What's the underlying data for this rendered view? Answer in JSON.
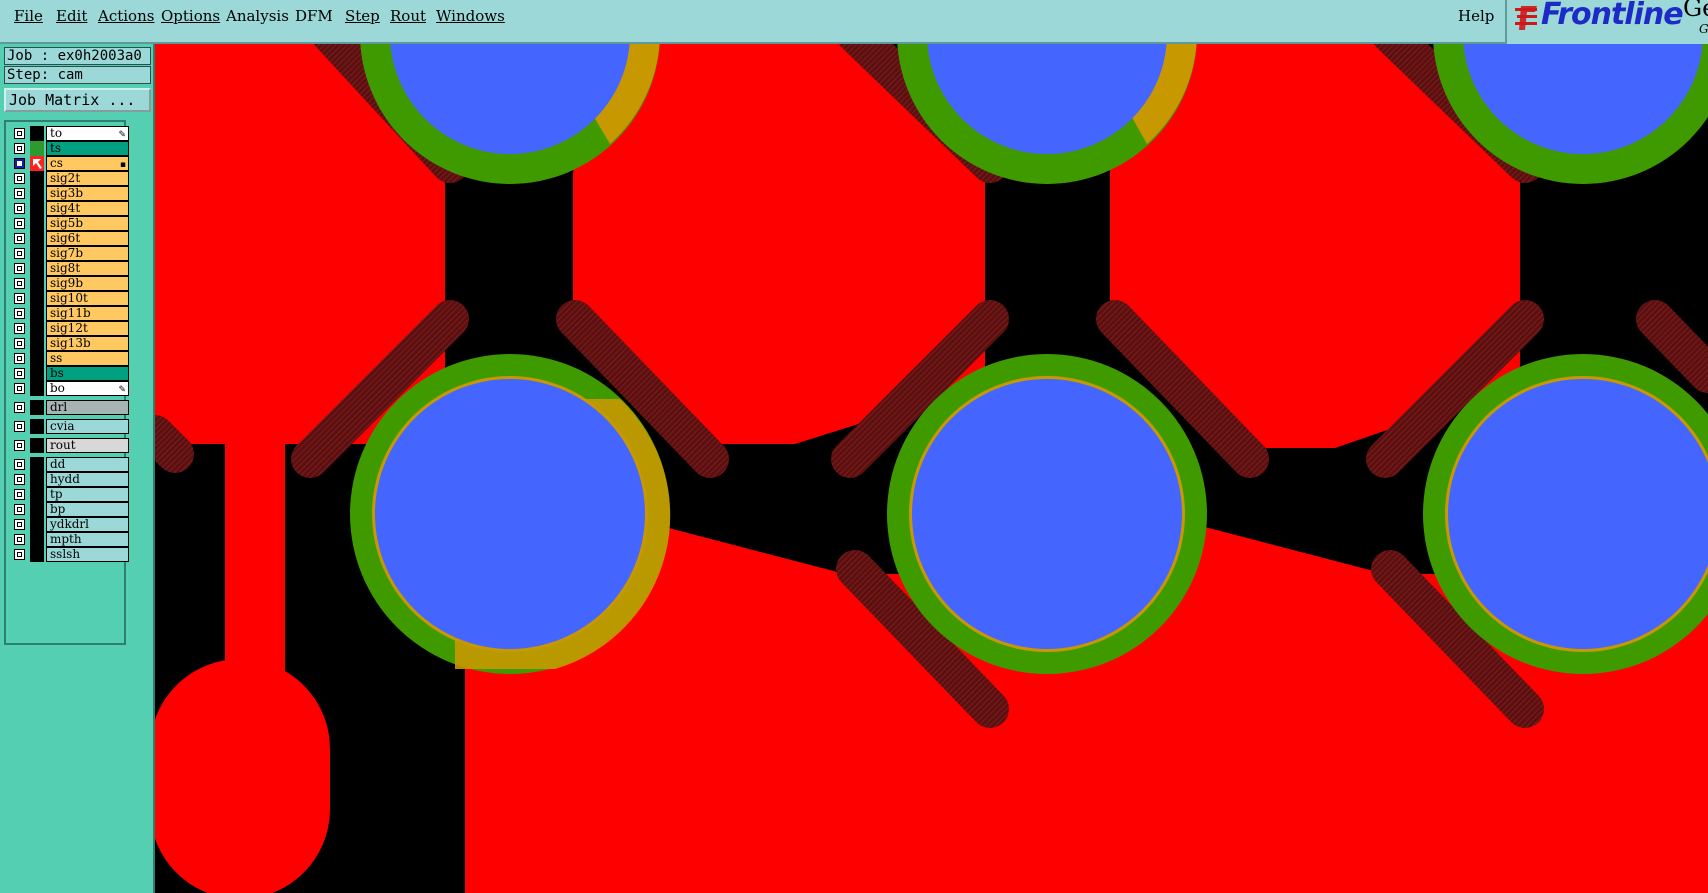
{
  "menubar": {
    "items": [
      "File",
      "Edit",
      "Actions",
      "Options",
      "Analysis",
      "DFM",
      "Step",
      "Rout",
      "Windows"
    ],
    "help": "Help"
  },
  "brand": {
    "name": "Frontline",
    "tail1": "Ge",
    "tail2": "G"
  },
  "job": {
    "label": "Job : ex0h2003a0",
    "step": "Step: cam",
    "matrix_button": "Job Matrix ..."
  },
  "layers": [
    {
      "name": "to",
      "color": "#ffffff",
      "checked": false,
      "marker": "pencil"
    },
    {
      "name": "ts",
      "color": "#00a080",
      "checked": false,
      "swatch": "#2e9a2e"
    },
    {
      "name": "cs",
      "color": "#ffc860",
      "checked": true,
      "swatch": "#ff2020",
      "marker": "square",
      "cursor": true
    },
    {
      "name": "sig2t",
      "color": "#ffc860",
      "checked": false
    },
    {
      "name": "sig3b",
      "color": "#ffc860",
      "checked": false
    },
    {
      "name": "sig4t",
      "color": "#ffc860",
      "checked": false
    },
    {
      "name": "sig5b",
      "color": "#ffc860",
      "checked": false
    },
    {
      "name": "sig6t",
      "color": "#ffc860",
      "checked": false
    },
    {
      "name": "sig7b",
      "color": "#ffc860",
      "checked": false
    },
    {
      "name": "sig8t",
      "color": "#ffc860",
      "checked": false
    },
    {
      "name": "sig9b",
      "color": "#ffc860",
      "checked": false
    },
    {
      "name": "sig10t",
      "color": "#ffc860",
      "checked": false
    },
    {
      "name": "sig11b",
      "color": "#ffc860",
      "checked": false
    },
    {
      "name": "sig12t",
      "color": "#ffc860",
      "checked": false
    },
    {
      "name": "sig13b",
      "color": "#ffc860",
      "checked": false
    },
    {
      "name": "ss",
      "color": "#ffc860",
      "checked": false
    },
    {
      "name": "bs",
      "color": "#00a080",
      "checked": false
    },
    {
      "name": "bo",
      "color": "#ffffff",
      "checked": false,
      "marker": "pencil"
    },
    {
      "name": "drl",
      "color": "#a8b4b4",
      "checked": false,
      "group": true
    },
    {
      "name": "cvia",
      "color": "#9cd8d8",
      "checked": false,
      "group": true
    },
    {
      "name": "rout",
      "color": "#d8d8d8",
      "checked": false,
      "group": true
    },
    {
      "name": "dd",
      "color": "#9cd8d8",
      "checked": false,
      "group": true
    },
    {
      "name": "hydd",
      "color": "#9cd8d8",
      "checked": false
    },
    {
      "name": "tp",
      "color": "#9cd8d8",
      "checked": false
    },
    {
      "name": "bp",
      "color": "#9cd8d8",
      "checked": false
    },
    {
      "name": "ydkdrl",
      "color": "#9cd8d8",
      "checked": false
    },
    {
      "name": "mpth",
      "color": "#9cd8d8",
      "checked": false
    },
    {
      "name": "sslsh",
      "color": "#9cd8d8",
      "checked": false
    }
  ],
  "colors": {
    "copper": "#ff0000",
    "drill": "#4466ff",
    "ring_green": "#3f9a00",
    "ring_gold": "#c89800",
    "trace_dark": "#6a1414",
    "bg": "#000000"
  }
}
